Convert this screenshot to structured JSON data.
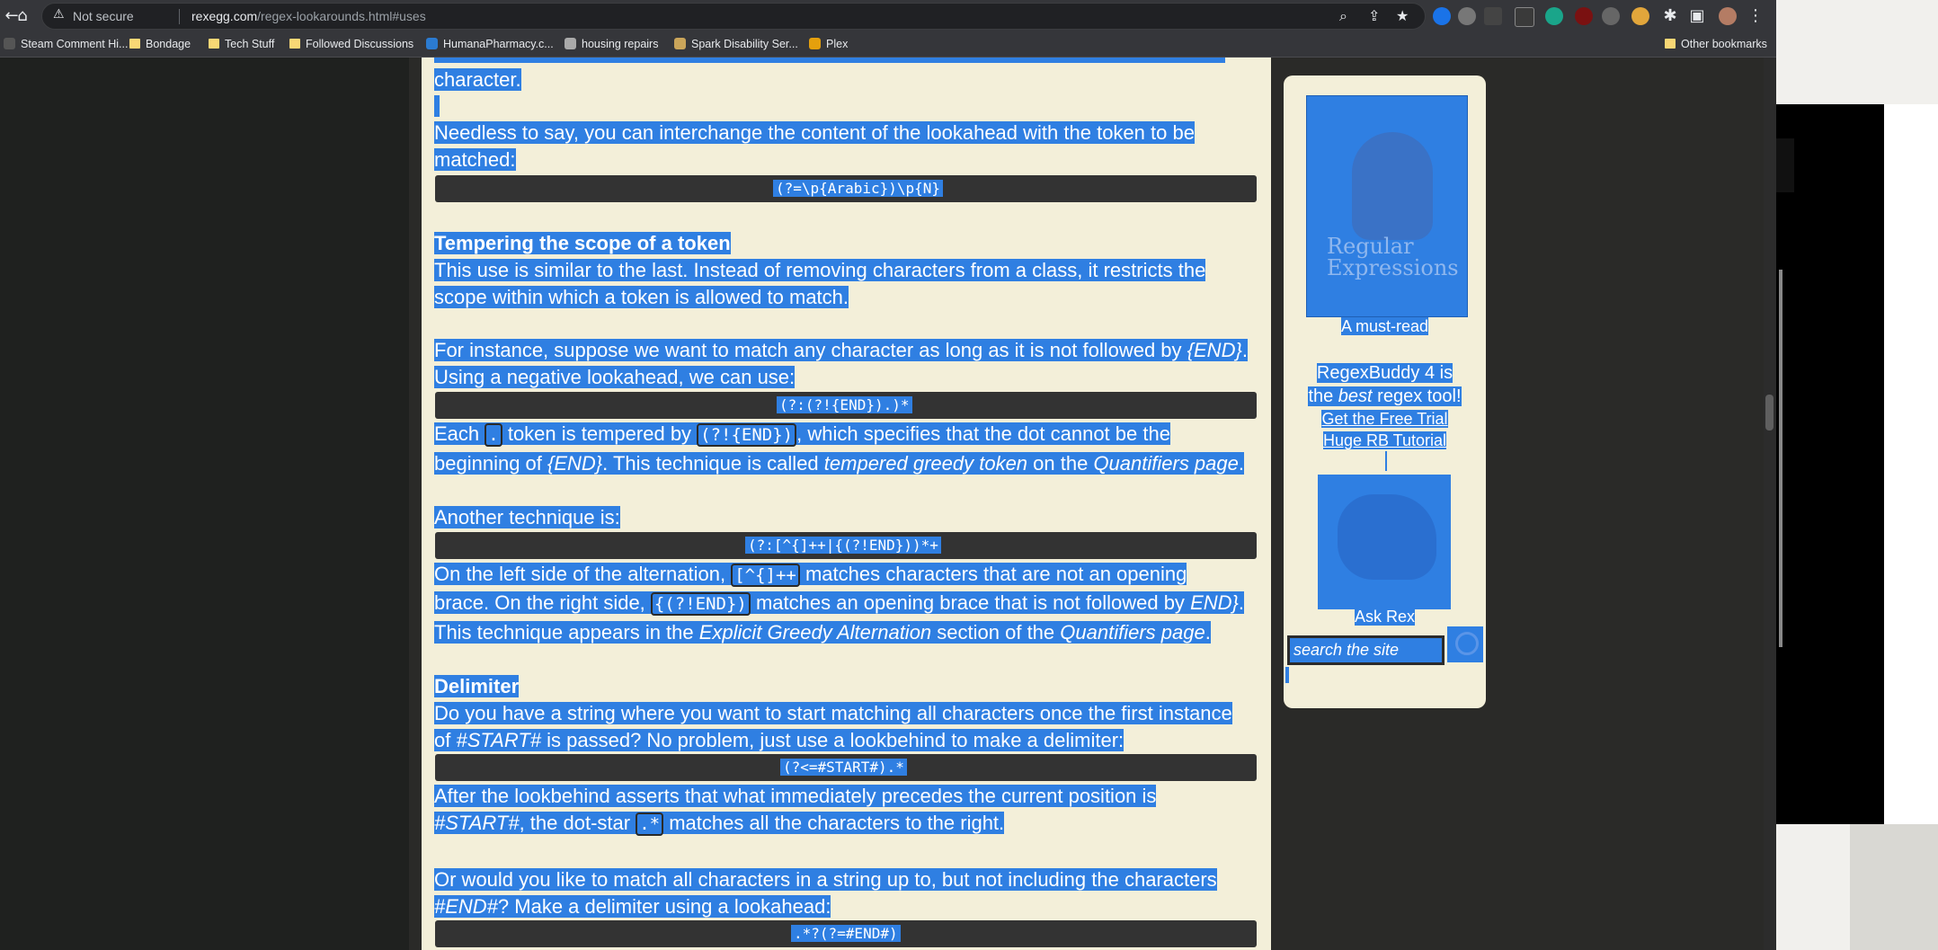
{
  "browser": {
    "security_label": "Not secure",
    "url_domain": "rexegg.com",
    "url_path": "/regex-lookarounds.html#uses",
    "bookmarks": [
      "Steam Comment Hi...",
      "Bondage",
      "Tech Stuff",
      "Followed Discussions",
      "HumanaPharmacy.c...",
      "housing repairs",
      "Spark Disability Ser...",
      "Plex"
    ],
    "other_bookmarks": "Other bookmarks",
    "icons": [
      "back-icon",
      "home-icon",
      "warning-icon",
      "zoom-icon",
      "share-icon",
      "star-icon",
      "extensions-icon",
      "sidepanel-icon",
      "profile-icon",
      "menu-icon"
    ]
  },
  "article": {
    "line_top": "character.",
    "p1_l1": "Needless to say, you can interchange the content of the lookahead with the token to be",
    "p1_l2": "matched:",
    "code1": "(?=\\p{Arabic})\\p{N}",
    "h_tempering": "Tempering the scope of a token",
    "p2_l1": "This use is similar to the last. Instead of removing characters from a class, it restricts the",
    "p2_l2": "scope within which a token is allowed to match.",
    "p3_l1a": "For instance, suppose we want to match any character as long as it is not followed by ",
    "p3_l1b": "{END}",
    "p3_l1c": ".",
    "p3_l2": "Using a negative lookahead, we can use:",
    "code2": "(?:(?!{END}).)*",
    "p4_a": "Each ",
    "p4_code1": ".",
    "p4_b": " token is tempered by ",
    "p4_code2": "(?!{END})",
    "p4_c": ", which specifies that the dot cannot be the",
    "p4_l2a": "beginning of ",
    "p4_l2b": "{END}",
    "p4_l2c": ". This technique is called ",
    "p4_l2d": "tempered greedy token",
    "p4_l2e": " on the ",
    "p4_l2f": "Quantifiers page",
    "p4_l2g": ".",
    "p5": "Another technique is:",
    "code3": "(?:[^{]++|{(?!END}))*+",
    "p6_l1a": "On the left side of the alternation, ",
    "p6_code1": "[^{]++",
    "p6_l1b": " matches characters that are not an opening",
    "p6_l2a": "brace. On the right side, ",
    "p6_code2": "{(?!END})",
    "p6_l2b": " matches an opening brace that is not followed by ",
    "p6_l2c": "END}",
    "p6_l2d": ".",
    "p6_l3a": "This technique appears in the ",
    "p6_l3b": "Explicit Greedy Alternation",
    "p6_l3c": " section of the ",
    "p6_l3d": "Quantifiers page",
    "p6_l3e": ".",
    "h_delimiter": "Delimiter",
    "p7_l1": "Do you have a string where you want to start matching all characters once the first instance",
    "p7_l2a": "of ",
    "p7_l2b": "#START#",
    "p7_l2c": " is passed? No problem, just use a lookbehind to make a delimiter:",
    "code4": "(?<=#START#).*",
    "p8_l1": "After the lookbehind asserts that what immediately precedes the current position is",
    "p8_l2a": "#START#",
    "p8_l2b": ", the dot-star ",
    "p8_code": ".*",
    "p8_l2c": " matches all the characters to the right.",
    "p9_l1": "Or would you like to match all characters in a string up to, but not including the characters",
    "p9_l2a": "#END#",
    "p9_l2b": "? Make a delimiter using a lookahead:",
    "code5": ".*?(?=#END#)"
  },
  "sidebar": {
    "book_title": "Regular Expressions",
    "must_read": "A must-read",
    "rb_l1": "RegexBuddy 4 is",
    "rb_l2a": "the ",
    "rb_l2b": "best",
    "rb_l2c": " regex tool!",
    "link_trial": "Get the Free Trial",
    "link_tutorial": "Huge RB Tutorial",
    "ask_rex": "Ask Rex",
    "search_placeholder": "search the site"
  },
  "colors": {
    "selection": "#2f7fe2",
    "page_bg": "#f3efd9",
    "dark_bg": "#1f211f",
    "code_bg": "#333333"
  }
}
